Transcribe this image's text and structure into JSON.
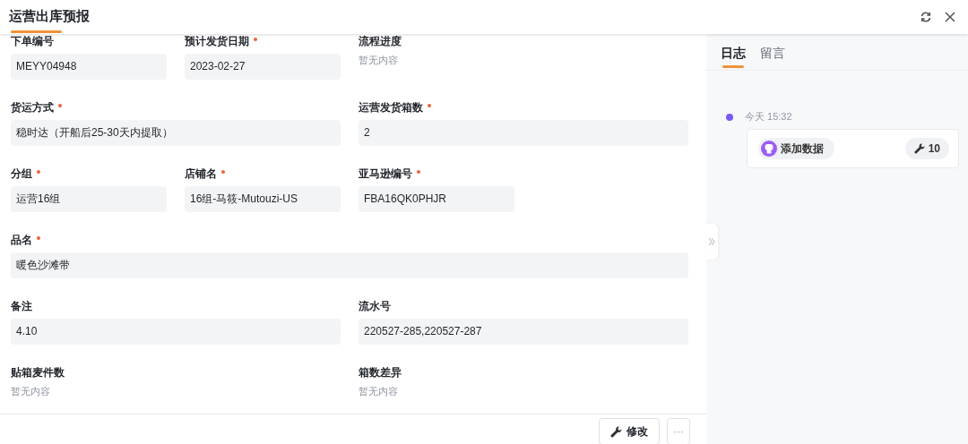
{
  "header": {
    "title": "运营出库预报"
  },
  "fields": [
    {
      "label": "下单编号",
      "required": false,
      "kind": "value",
      "value": "MEYY04948"
    },
    {
      "label": "预计发货日期",
      "required": true,
      "kind": "value",
      "value": "2023-02-27"
    },
    {
      "label": "流程进度",
      "required": false,
      "kind": "empty",
      "value": "暂无内容"
    },
    {
      "label": "货运方式",
      "required": true,
      "kind": "value",
      "value": "稳时达（开船后25-30天内提取）"
    },
    {
      "label": "运营发货箱数",
      "required": true,
      "kind": "value",
      "value": "2"
    },
    {
      "label": "分组",
      "required": true,
      "kind": "value",
      "value": "运营16组"
    },
    {
      "label": "店铺名",
      "required": true,
      "kind": "value",
      "value": "16组-马筱-Mutouzi-US"
    },
    {
      "label": "亚马逊编号",
      "required": true,
      "kind": "value",
      "value": "FBA16QK0PHJR"
    },
    {
      "label": "品名",
      "required": true,
      "kind": "value",
      "value": "暖色沙滩带"
    },
    {
      "label": "备注",
      "required": false,
      "kind": "value",
      "value": "4.10"
    },
    {
      "label": "流水号",
      "required": false,
      "kind": "value",
      "value": "220527-285,220527-287"
    },
    {
      "label": "贴箱麦件数",
      "required": false,
      "kind": "empty",
      "value": "暂无内容"
    },
    {
      "label": "箱数差异",
      "required": false,
      "kind": "empty",
      "value": "暂无内容"
    }
  ],
  "footer": {
    "buttons": [
      {
        "kind": "edit",
        "label": "修改"
      },
      {
        "kind": "more",
        "label": "···"
      }
    ]
  },
  "side_panel": {
    "tabs": [
      {
        "label": "日志",
        "selected": true
      },
      {
        "label": "留言",
        "selected": false
      }
    ],
    "log": [
      {
        "time": "今天 15:32",
        "action": "添加数据",
        "count": "10"
      }
    ]
  }
}
